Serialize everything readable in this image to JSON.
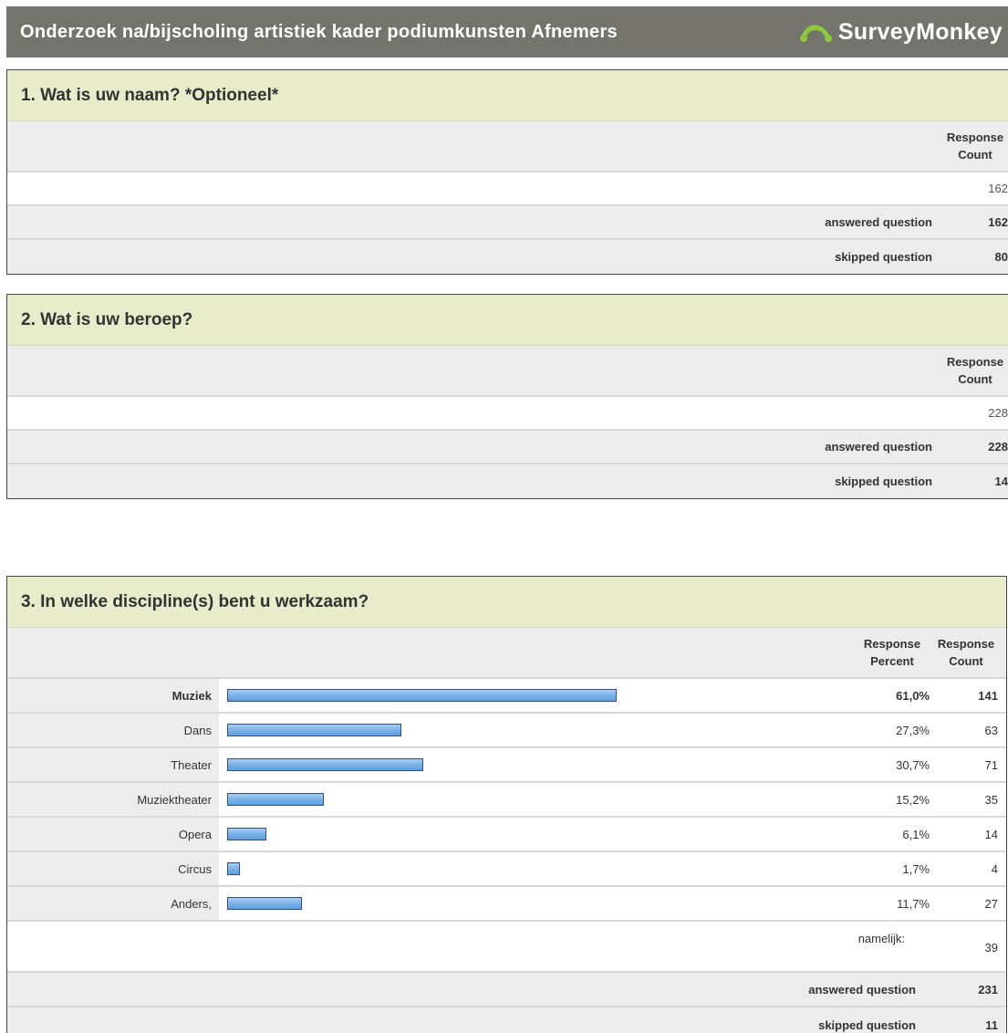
{
  "header": {
    "title": "Onderzoek na/bijscholing artistiek kader podiumkunsten Afnemers",
    "logo_text": "SurveyMonkey",
    "bg_color": "#74746c"
  },
  "q1": {
    "title": "1. Wat is uw naam? *Optioneel*",
    "col_header": "Response Count",
    "count": "162",
    "answered_label": "answered question",
    "answered": "162",
    "skipped_label": "skipped question",
    "skipped": "80"
  },
  "q2": {
    "title": "2. Wat is uw beroep?",
    "col_header": "Response Count",
    "count": "228",
    "answered_label": "answered question",
    "answered": "228",
    "skipped_label": "skipped question",
    "skipped": "14"
  },
  "q3": {
    "title": "3. In welke discipline(s) bent u werkzaam?",
    "col_percent": "Response Percent",
    "col_count": "Response Count",
    "other_label": "namelijk:",
    "other_count": "39",
    "answered_label": "answered question",
    "answered": "231",
    "skipped_label": "skipped question",
    "skipped": "11"
  },
  "chart_data": {
    "type": "bar",
    "categories": [
      "Muziek",
      "Dans",
      "Theater",
      "Muziektheater",
      "Opera",
      "Circus",
      "Anders,"
    ],
    "series": [
      {
        "values": [
          61.0,
          27.3,
          30.7,
          15.2,
          6.1,
          1.7,
          11.7
        ]
      }
    ],
    "percent_labels": [
      "61,0%",
      "27,3%",
      "30,7%",
      "15,2%",
      "6,1%",
      "1,7%",
      "11,7%"
    ],
    "counts": [
      "141",
      "63",
      "71",
      "35",
      "14",
      "4",
      "27"
    ],
    "title": "",
    "xlabel": "",
    "ylabel": "",
    "ylim": [
      0,
      100
    ],
    "highlight_top": true,
    "bar_color": "#7ab2e8"
  }
}
